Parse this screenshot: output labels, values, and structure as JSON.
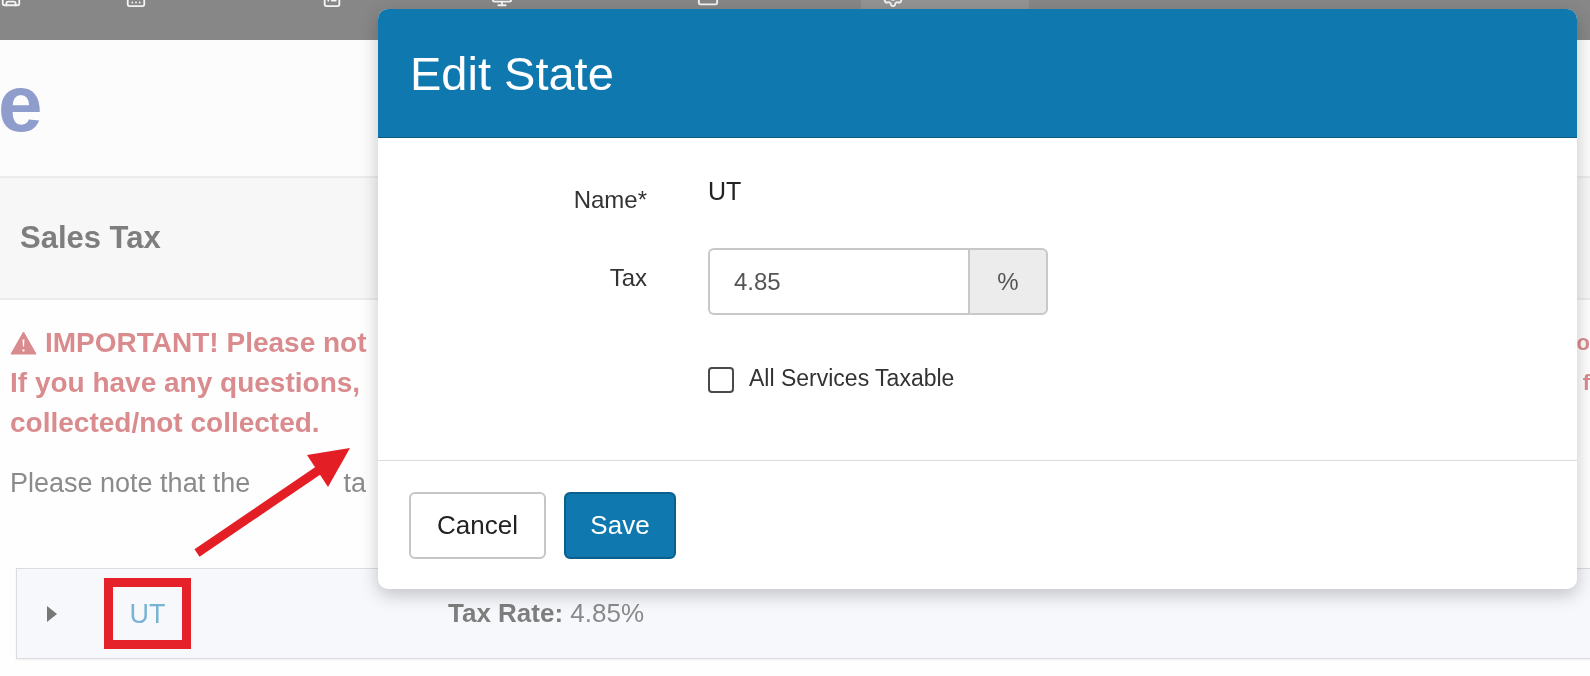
{
  "nav": {
    "items": [
      {
        "selected": false
      },
      {
        "selected": false
      },
      {
        "selected": false
      },
      {
        "selected": false
      },
      {
        "selected": false
      },
      {
        "selected": true
      }
    ]
  },
  "page": {
    "title": "e",
    "panel_title": "Sales Tax",
    "alert": {
      "lines_left": [
        "IMPORTANT! Please not",
        "If you have any questions,",
        "collected/not collected."
      ],
      "lines_right": [
        "o",
        "f"
      ]
    },
    "note_parts": [
      "Please note that the",
      "ta"
    ],
    "rows": [
      {
        "state": "UT",
        "expanded": false,
        "rate": "**Tax Rate:** 4.85%"
      }
    ]
  },
  "modal": {
    "title": "Edit State",
    "fields": [
      {
        "kind": "text",
        "label": "Name*",
        "value": "UT"
      },
      {
        "kind": "addon",
        "label": "Tax",
        "value": "4.85",
        "addon": "%"
      },
      {
        "kind": "checkbox",
        "label": "All Services Taxable",
        "checked": false
      }
    ],
    "buttons": [
      {
        "kind": "default",
        "label": "Cancel"
      },
      {
        "kind": "primary",
        "label": "Save"
      }
    ]
  }
}
